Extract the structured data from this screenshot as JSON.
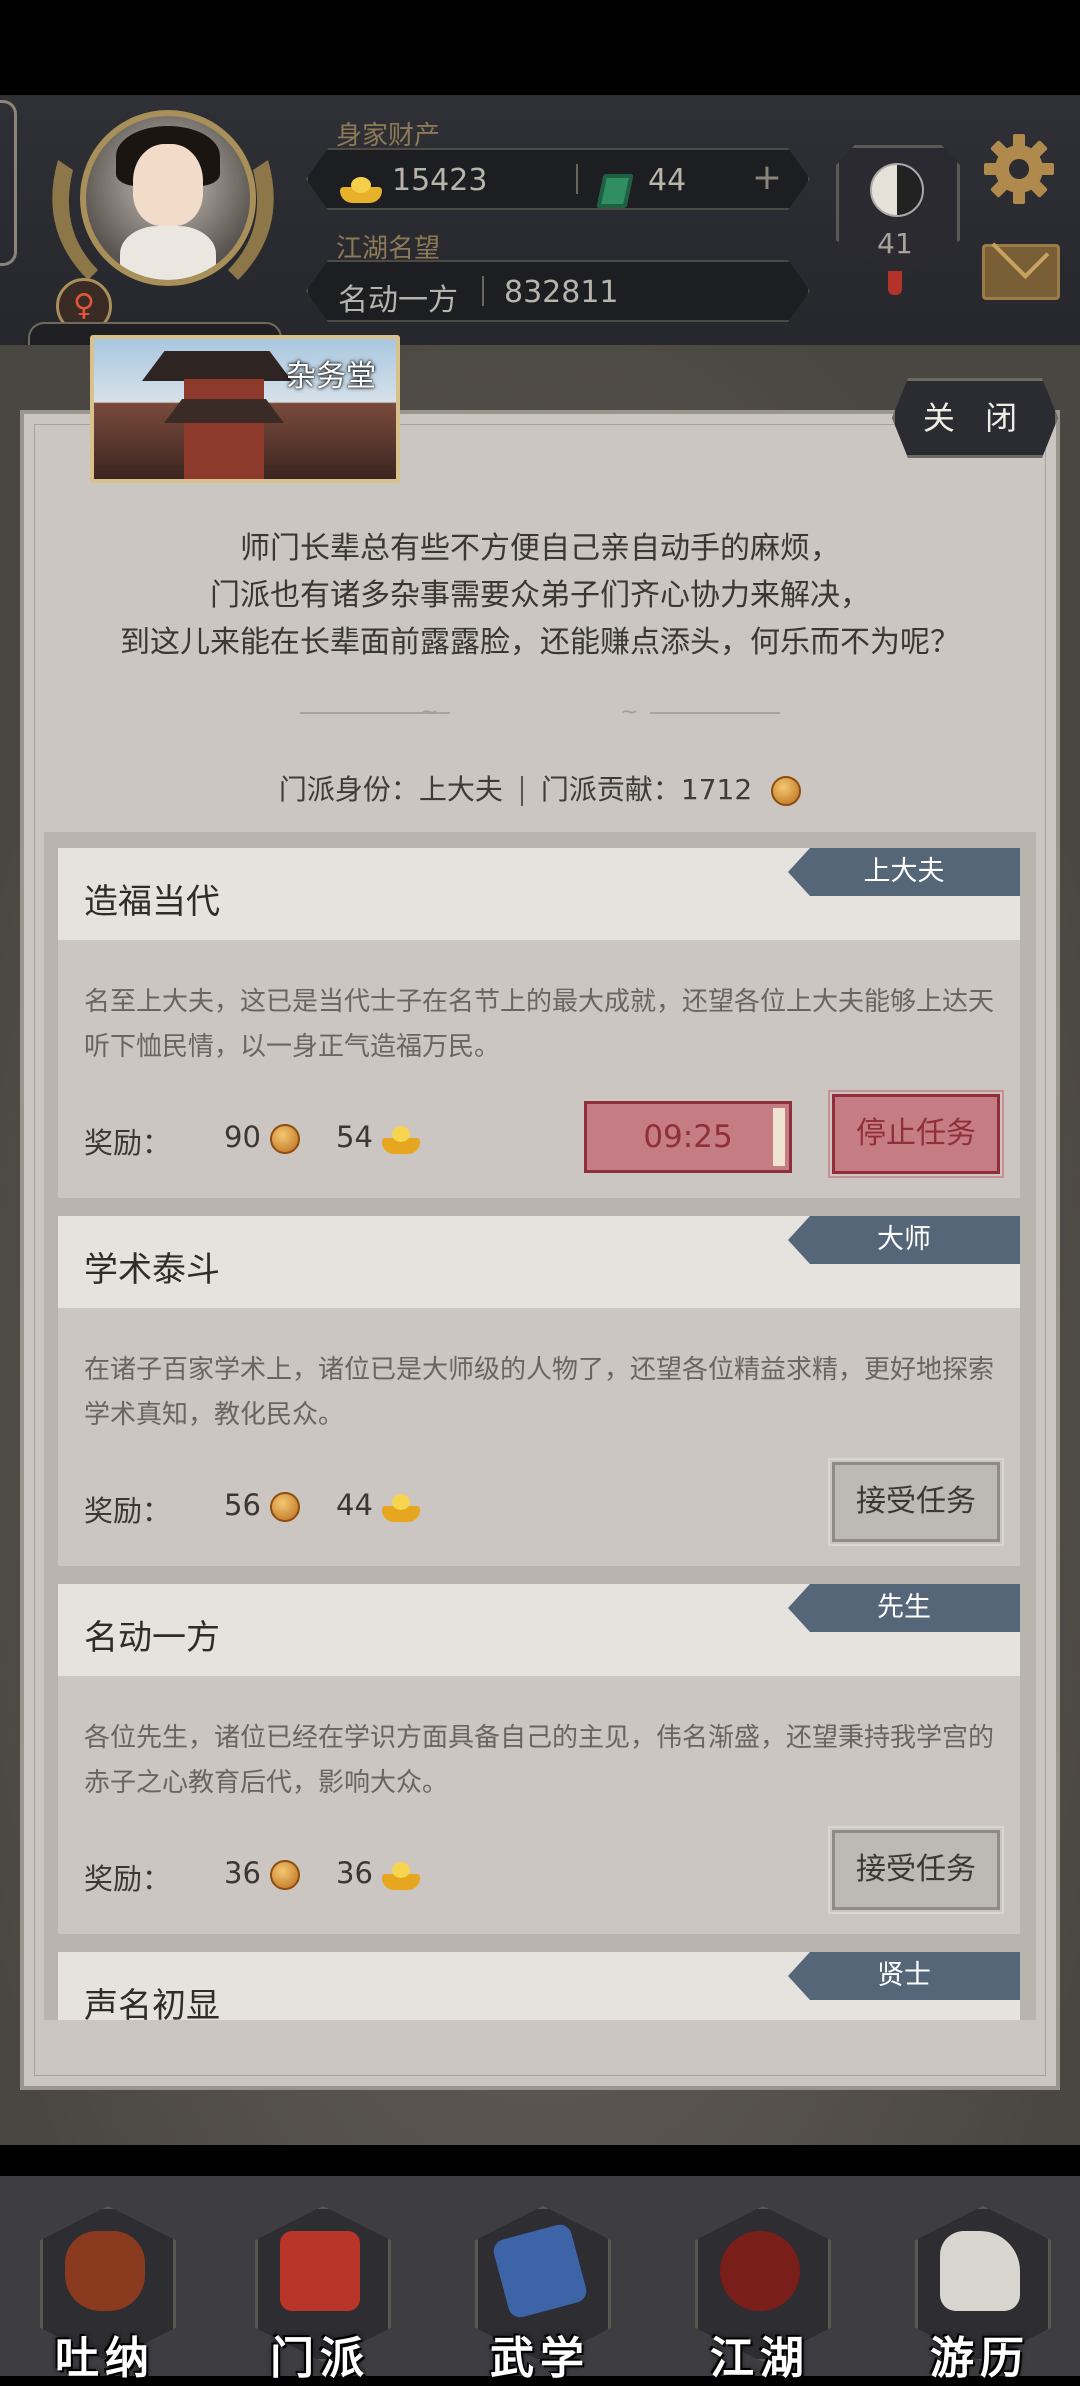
{
  "header": {
    "wealth_label": "身家财产",
    "gold_amount": "15423",
    "jade_amount": "44",
    "add_symbol": "+",
    "fame_label": "江湖名望",
    "fame_title": "名动一方",
    "fame_value": "832811",
    "taiji_level": "41",
    "gender_symbol": "♀"
  },
  "panel": {
    "hall_name": "杂务堂",
    "close_label": "关 闭",
    "intro_lines": [
      "师门长辈总有些不方便自己亲自动手的麻烦，",
      "门派也有诸多杂事需要众弟子们齐心协力来解决，",
      "到这儿来能在长辈面前露露脸，还能赚点添头，何乐而不为呢？"
    ],
    "identity_label": "门派身份：上大夫",
    "contribution_label": "门派贡献：1712"
  },
  "tasks": [
    {
      "title": "造福当代",
      "rank": "上大夫",
      "desc": "名至上大夫，这已是当代士子在名节上的最大成就，还望各位上大夫能够上达天听下恤民情，以一身正气造福万民。",
      "reward_label": "奖励：",
      "reward_coin": "90",
      "reward_gold": "54",
      "timer": "09:25",
      "action": "停止任务"
    },
    {
      "title": "学术泰斗",
      "rank": "大师",
      "desc": "在诸子百家学术上，诸位已是大师级的人物了，还望各位精益求精，更好地探索学术真知，教化民众。",
      "reward_label": "奖励：",
      "reward_coin": "56",
      "reward_gold": "44",
      "action": "接受任务"
    },
    {
      "title": "名动一方",
      "rank": "先生",
      "desc": "各位先生，诸位已经在学识方面具备自己的主见，伟名渐盛，还望秉持我学宫的赤子之心教育后代，影响大众。",
      "reward_label": "奖励：",
      "reward_coin": "36",
      "reward_gold": "36",
      "action": "接受任务"
    },
    {
      "title": "声名初显",
      "rank": "贤士"
    }
  ],
  "nav": [
    {
      "label": "吐纳",
      "icon": "gourd-icon",
      "color": "#8a3b1f"
    },
    {
      "label": "门派",
      "icon": "banner-icon",
      "color": "#b8352a"
    },
    {
      "label": "武学",
      "icon": "scroll-books-icon",
      "color": "#3e64a8"
    },
    {
      "label": "江湖",
      "icon": "bamboo-hat-icon",
      "color": "#7a1e1a"
    },
    {
      "label": "游历",
      "icon": "white-horse-icon",
      "color": "#d9d6d0"
    }
  ]
}
